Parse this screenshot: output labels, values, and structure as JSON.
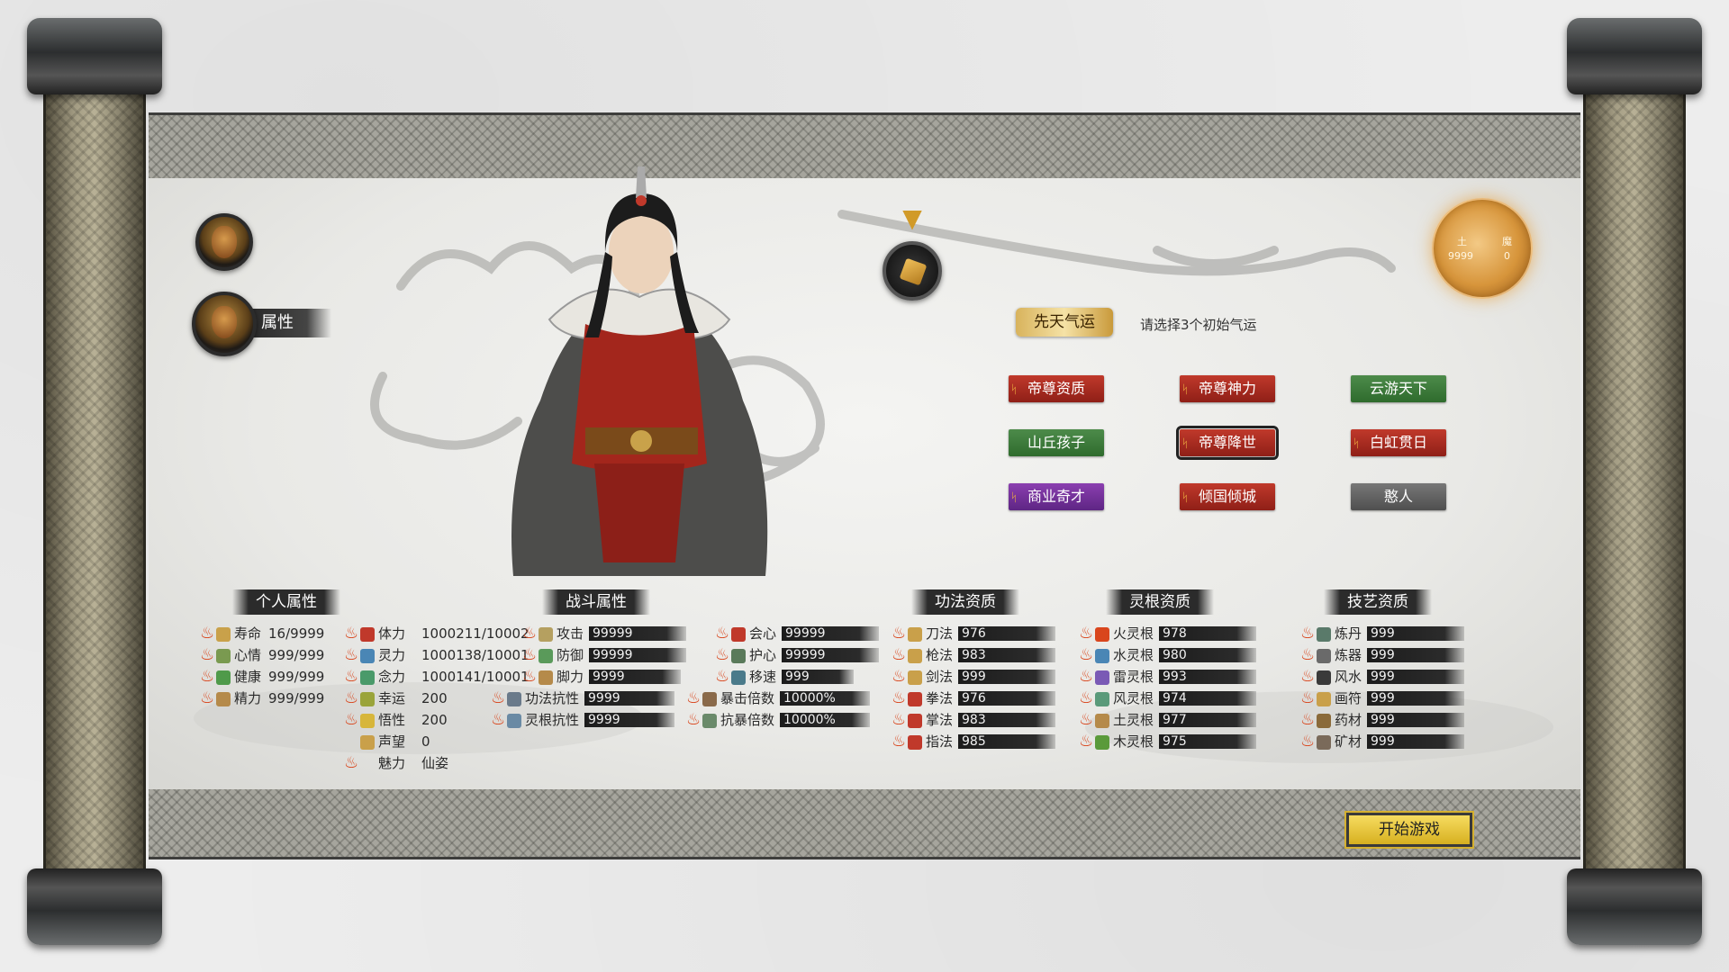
{
  "sidebar": {
    "attr_tab_label": "属性"
  },
  "gold_disc": {
    "label_left": "土",
    "label_right": "魔",
    "value_left": "9999",
    "value_right": "0"
  },
  "fortune": {
    "tag": "先天气运",
    "hint": "请选择3个初始气运",
    "options": [
      {
        "label": "帝尊资质",
        "color": "red",
        "selected": false
      },
      {
        "label": "帝尊神力",
        "color": "red",
        "selected": false
      },
      {
        "label": "云游天下",
        "color": "green",
        "selected": false
      },
      {
        "label": "山丘孩子",
        "color": "green",
        "selected": false
      },
      {
        "label": "帝尊降世",
        "color": "red",
        "selected": true
      },
      {
        "label": "白虹贯日",
        "color": "red",
        "selected": false
      },
      {
        "label": "商业奇才",
        "color": "purple",
        "selected": false
      },
      {
        "label": "倾国倾城",
        "color": "red",
        "selected": false
      },
      {
        "label": "憨人",
        "color": "gray",
        "selected": false
      }
    ]
  },
  "personal": {
    "title": "个人属性",
    "rows": [
      {
        "name": "寿命",
        "value": "16/9999"
      },
      {
        "name": "心情",
        "value": "999/999"
      },
      {
        "name": "健康",
        "value": "999/999"
      },
      {
        "name": "精力",
        "value": "999/999"
      }
    ],
    "rows2": [
      {
        "name": "体力",
        "value": "1000211/10002"
      },
      {
        "name": "灵力",
        "value": "1000138/10001"
      },
      {
        "name": "念力",
        "value": "1000141/10001"
      },
      {
        "name": "幸运",
        "value": "200"
      },
      {
        "name": "悟性",
        "value": "200"
      },
      {
        "name": "声望",
        "value": "0"
      },
      {
        "name": "魅力",
        "value": "仙姿"
      }
    ]
  },
  "combat": {
    "title": "战斗属性",
    "col1": [
      {
        "name": "攻击",
        "value": "99999"
      },
      {
        "name": "防御",
        "value": "99999"
      },
      {
        "name": "脚力",
        "value": "9999"
      },
      {
        "name": "功法抗性",
        "value": "9999"
      },
      {
        "name": "灵根抗性",
        "value": "9999"
      }
    ],
    "col2": [
      {
        "name": "会心",
        "value": "99999"
      },
      {
        "name": "护心",
        "value": "99999"
      },
      {
        "name": "移速",
        "value": "999"
      },
      {
        "name": "暴击倍数",
        "value": "10000%"
      },
      {
        "name": "抗暴倍数",
        "value": "10000%"
      }
    ]
  },
  "skills": {
    "title": "功法资质",
    "rows": [
      {
        "name": "刀法",
        "value": "976"
      },
      {
        "name": "枪法",
        "value": "983"
      },
      {
        "name": "剑法",
        "value": "999"
      },
      {
        "name": "拳法",
        "value": "976"
      },
      {
        "name": "掌法",
        "value": "983"
      },
      {
        "name": "指法",
        "value": "985"
      }
    ]
  },
  "roots": {
    "title": "灵根资质",
    "rows": [
      {
        "name": "火灵根",
        "value": "978"
      },
      {
        "name": "水灵根",
        "value": "980"
      },
      {
        "name": "雷灵根",
        "value": "993"
      },
      {
        "name": "风灵根",
        "value": "974"
      },
      {
        "name": "土灵根",
        "value": "977"
      },
      {
        "name": "木灵根",
        "value": "975"
      }
    ]
  },
  "crafts": {
    "title": "技艺资质",
    "rows": [
      {
        "name": "炼丹",
        "value": "999"
      },
      {
        "name": "炼器",
        "value": "999"
      },
      {
        "name": "风水",
        "value": "999"
      },
      {
        "name": "画符",
        "value": "999"
      },
      {
        "name": "药材",
        "value": "999"
      },
      {
        "name": "矿材",
        "value": "999"
      }
    ]
  },
  "start_button": "开始游戏",
  "colors": {
    "fire": "#d9461d",
    "gold": "#d7953b",
    "fortune_red": "#c0392b",
    "fortune_green": "#4d8b4a",
    "fortune_purple": "#8b3fb0"
  }
}
